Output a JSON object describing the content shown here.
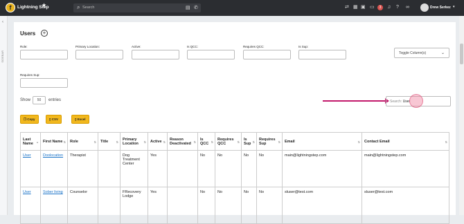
{
  "header": {
    "brand": "Lightning Step",
    "logo_letter": "f",
    "search_placeholder": "Search",
    "notification_count": "3",
    "user_name": "Drew Serkez"
  },
  "sidebar": {
    "vertical_label": "SIDEBAR"
  },
  "page": {
    "title": "Users"
  },
  "filters": [
    {
      "label": "Role:"
    },
    {
      "label": "Primary Location:"
    },
    {
      "label": "Active:"
    },
    {
      "label": "Is QCC:"
    },
    {
      "label": "Requires QCC:"
    },
    {
      "label": "Is Sup:"
    },
    {
      "label": "Requires Sup:"
    }
  ],
  "toggle_columns": "Toggle Column(s)",
  "entries": {
    "show": "Show",
    "value": "50",
    "suffix": "entries"
  },
  "table_search": {
    "label": "Search:",
    "value": "User"
  },
  "export_buttons": [
    {
      "label": "Copy"
    },
    {
      "label": "CSV"
    },
    {
      "label": "Excel"
    }
  ],
  "table": {
    "columns": [
      "Last Name",
      "First Name",
      "Role",
      "Title",
      "Primary Location",
      "Active",
      "Reason Deactivated",
      "Is QCC",
      "Requires QCC",
      "Is Sup",
      "Requires Sup",
      "Email",
      "Contact Email"
    ],
    "rows": [
      [
        "User",
        "Doolocation",
        "Therapist",
        "",
        "Dog Treatment Center",
        "Yes",
        "",
        "No",
        "No",
        "No",
        "No",
        "main@lightningstep.com",
        "main@lightningstep.com"
      ],
      [
        "User",
        "Sober living",
        "Counselor",
        "",
        "FRecovery Lodge",
        "Yes",
        "",
        "No",
        "No",
        "No",
        "No",
        "sluser@test.com",
        "sluser@test.com"
      ]
    ]
  }
}
